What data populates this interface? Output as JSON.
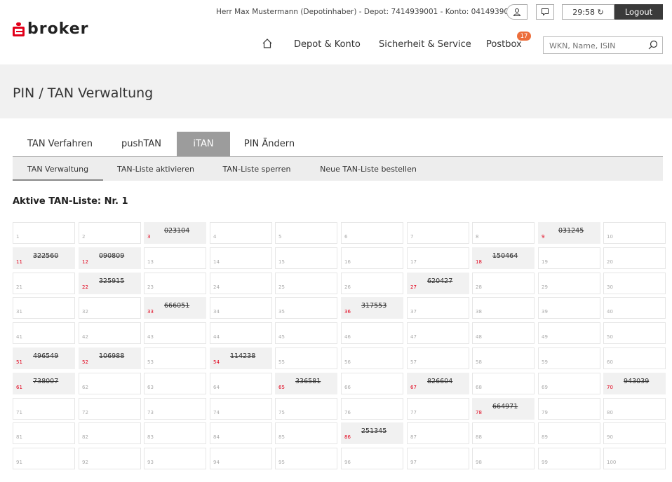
{
  "header": {
    "brand": "broker",
    "user_info": "Herr Max Mustermann (Depotinhaber)  -  Depot: 7414939001  -  Konto: 0414939007",
    "timer": "29:58 ↻",
    "logout_label": "Logout",
    "nav": {
      "depot_konto": "Depot & Konto",
      "sicherheit": "Sicherheit & Service",
      "postbox": "Postbox",
      "postbox_badge": "17"
    },
    "search_placeholder": "WKN, Name, ISIN"
  },
  "page_title": "PIN / TAN Verwaltung",
  "tabs": [
    "TAN Verfahren",
    "pushTAN",
    "iTAN",
    "PIN Ändern"
  ],
  "subtabs": [
    "TAN Verwaltung",
    "TAN-Liste aktivieren",
    "TAN-Liste sperren",
    "Neue TAN-Liste bestellen"
  ],
  "list_title": "Aktive TAN-Liste: Nr. 1",
  "tan_list": {
    "columns": 10,
    "total": 100,
    "used": {
      "3": "023104",
      "9": "031245",
      "11": "322560",
      "12": "090809",
      "18": "150464",
      "22": "325915",
      "27": "620427",
      "33": "666051",
      "36": "317553",
      "51": "496549",
      "52": "106988",
      "54": "114238",
      "61": "738007",
      "65": "336581",
      "67": "826604",
      "70": "943039",
      "78": "664971",
      "86": "251345"
    }
  },
  "colors": {
    "accent_red": "#e2001a",
    "badge_orange": "#ec6e3b",
    "active_tab": "#9c9c9c",
    "logout_bg": "#3a3a3a"
  }
}
